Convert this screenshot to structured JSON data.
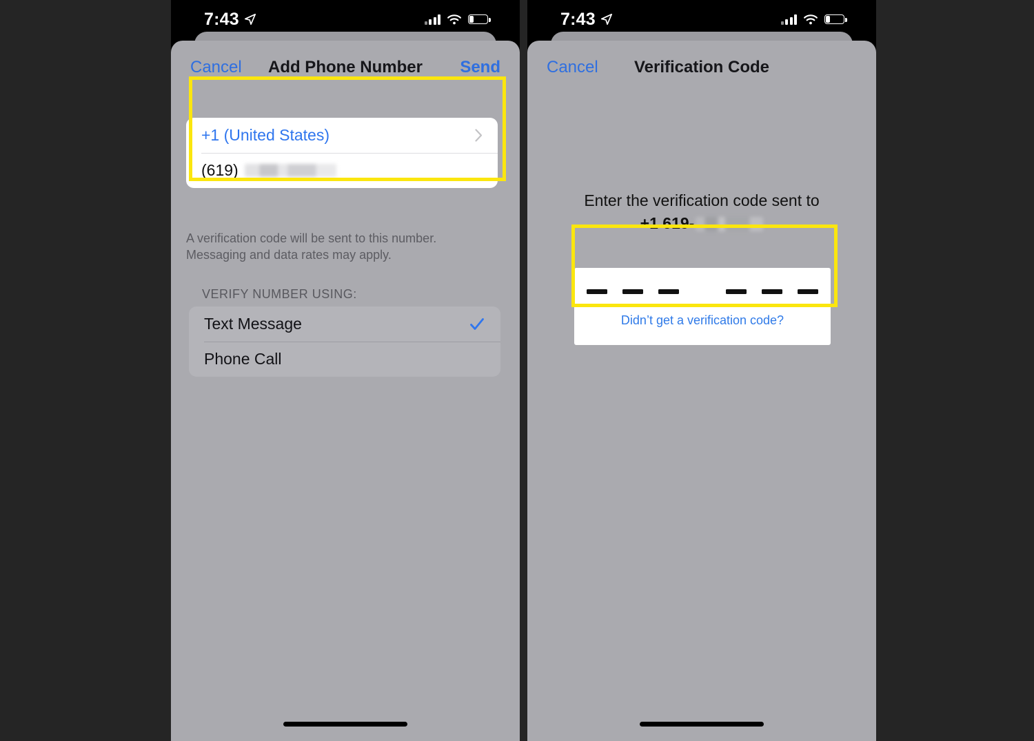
{
  "background_color": "#252525",
  "accent_colors": {
    "highlight": "#FBE60E",
    "link_blue": "#2F76EE",
    "sheet_gray": "#AAAAAF",
    "sheet_back_gray": "#9B9BA0",
    "option_card_gray": "#B4B4B9"
  },
  "status_bar": {
    "time": "7:43",
    "location_icon": "location-arrow-icon",
    "signal_icon": "cellular-signal-icon",
    "signal_bars_filled": 3,
    "signal_bars_total": 4,
    "wifi_icon": "wifi-icon",
    "battery_icon": "battery-icon",
    "battery_level_percent": 22
  },
  "left_screen": {
    "nav": {
      "cancel_label": "Cancel",
      "title": "Add Phone Number",
      "send_label": "Send"
    },
    "form": {
      "country_code_label": "+1 (United States)",
      "country_chevron_icon": "chevron-right-icon",
      "area_code": "(619)",
      "phone_number_redacted": "",
      "helper_line1": "A verification code will be sent to this number.",
      "helper_line2": "Messaging and data rates may apply."
    },
    "verify_section": {
      "header": "VERIFY NUMBER USING:",
      "options": [
        {
          "label": "Text Message",
          "selected": true,
          "check_icon": "checkmark-icon"
        },
        {
          "label": "Phone Call",
          "selected": false,
          "check_icon": ""
        }
      ]
    }
  },
  "right_screen": {
    "nav": {
      "cancel_label": "Cancel",
      "title": "Verification Code"
    },
    "prompt": {
      "line1": "Enter the verification code sent to",
      "number_prefix": "+1 619-",
      "number_redacted": ""
    },
    "code_entry": {
      "digit_count": 6,
      "digits": [
        "",
        "",
        "",
        "",
        "",
        ""
      ],
      "resend_link": "Didn’t get a verification code?"
    }
  },
  "annotations": {
    "highlight_phone_field": "yellow-highlight-box",
    "highlight_code_field": "yellow-highlight-box"
  }
}
